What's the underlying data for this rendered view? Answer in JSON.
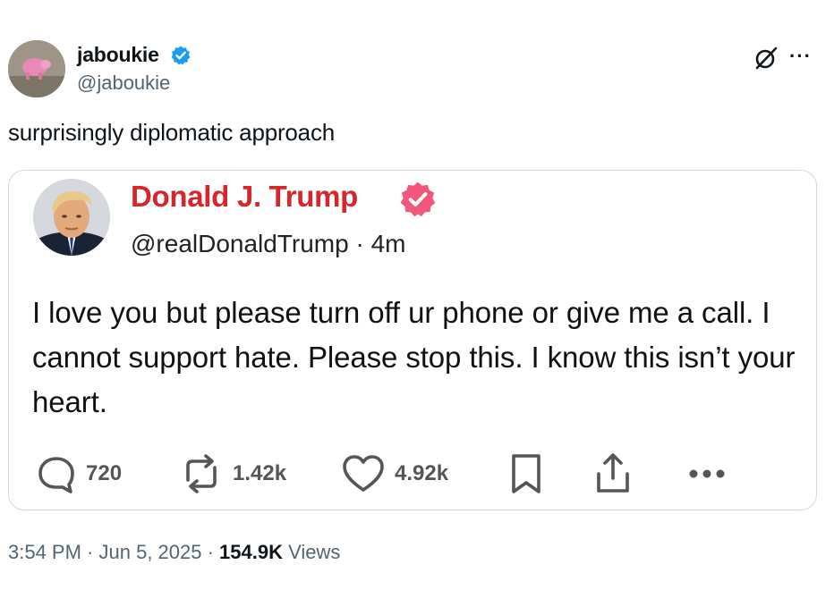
{
  "post": {
    "author_name": "jaboukie",
    "author_handle": "@jaboukie",
    "text": "surprisingly diplomatic approach",
    "icons": [
      "verified-badge-icon",
      "grok-icon",
      "more-options-icon"
    ],
    "accent_color": "#1d9bf0"
  },
  "quoted": {
    "name": "Donald J. Trump",
    "handle": "@realDonaldTrump",
    "separator": "·",
    "age": "4m",
    "text": "I love you but please turn off ur phone or give me a call. I cannot support hate. Please stop this. I know this isn’t your heart.",
    "name_color": "#d6262b",
    "badge_color": "#f0577a",
    "actions": {
      "replies": "720",
      "reposts": "1.42k",
      "likes": "4.92k"
    }
  },
  "meta": {
    "time": "3:54 PM",
    "sep1": " · ",
    "date": "Jun 5, 2025",
    "sep2": " · ",
    "views_count": "154.9K",
    "views_label": " Views"
  }
}
